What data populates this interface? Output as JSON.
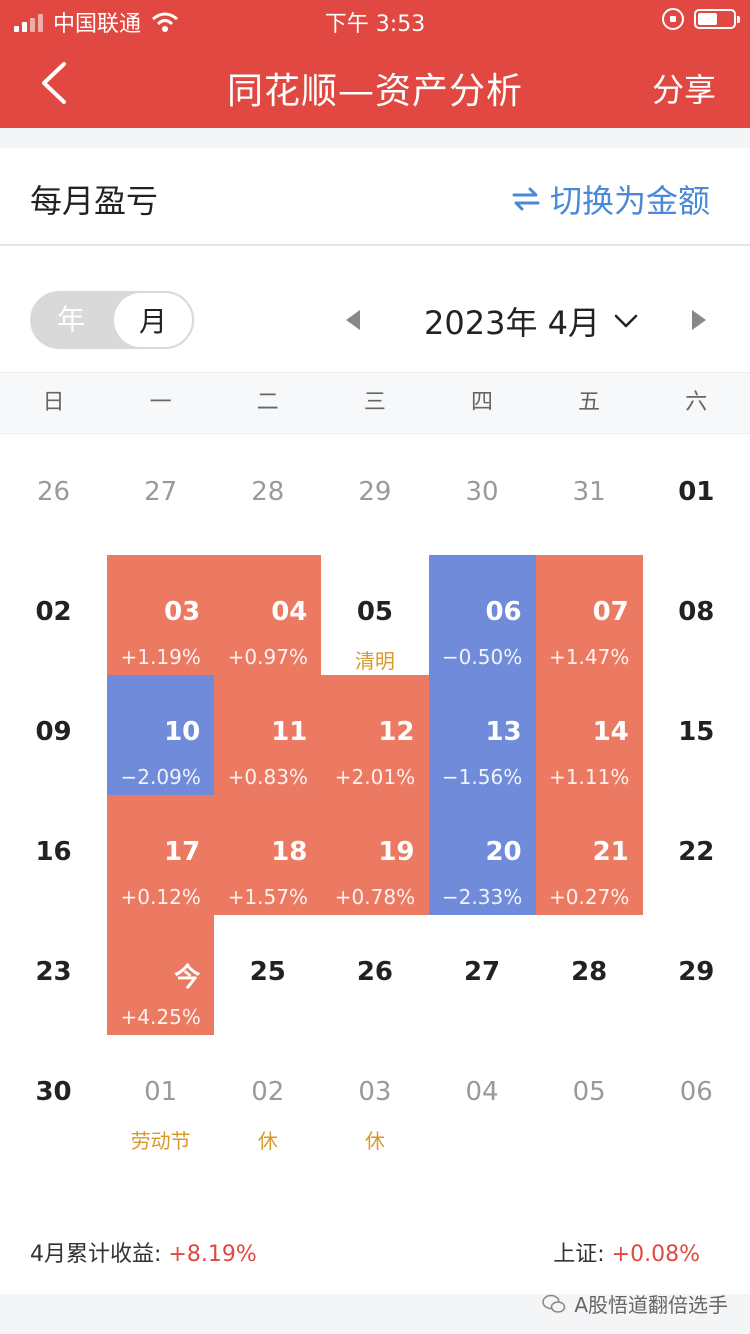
{
  "status_bar": {
    "carrier": "中国联通",
    "time": "下午 3:53"
  },
  "nav": {
    "title": "同花顺—资产分析",
    "share": "分享"
  },
  "section": {
    "title": "每月盈亏",
    "switch_label": "切换为金额"
  },
  "toggle": {
    "year": "年",
    "month": "月",
    "selected": "月"
  },
  "month_label": "2023年 4月",
  "weekdays": [
    "日",
    "一",
    "二",
    "三",
    "四",
    "五",
    "六"
  ],
  "colors": {
    "primary": "#e04841",
    "gain": "#ec7a62",
    "loss": "#6f8bd9",
    "holiday": "#d79a2b",
    "link": "#4a88d8"
  },
  "calendar": [
    [
      {
        "num": "26",
        "other": true
      },
      {
        "num": "27",
        "other": true
      },
      {
        "num": "28",
        "other": true
      },
      {
        "num": "29",
        "other": true
      },
      {
        "num": "30",
        "other": true
      },
      {
        "num": "31",
        "other": true
      },
      {
        "num": "01"
      }
    ],
    [
      {
        "num": "02"
      },
      {
        "num": "03",
        "change": "+1.19%",
        "trend": "up"
      },
      {
        "num": "04",
        "change": "+0.97%",
        "trend": "up"
      },
      {
        "num": "05",
        "note": "清明"
      },
      {
        "num": "06",
        "change": "−0.50%",
        "trend": "down"
      },
      {
        "num": "07",
        "change": "+1.47%",
        "trend": "up"
      },
      {
        "num": "08"
      }
    ],
    [
      {
        "num": "09"
      },
      {
        "num": "10",
        "change": "−2.09%",
        "trend": "down"
      },
      {
        "num": "11",
        "change": "+0.83%",
        "trend": "up"
      },
      {
        "num": "12",
        "change": "+2.01%",
        "trend": "up"
      },
      {
        "num": "13",
        "change": "−1.56%",
        "trend": "down"
      },
      {
        "num": "14",
        "change": "+1.11%",
        "trend": "up"
      },
      {
        "num": "15"
      }
    ],
    [
      {
        "num": "16"
      },
      {
        "num": "17",
        "change": "+0.12%",
        "trend": "up"
      },
      {
        "num": "18",
        "change": "+1.57%",
        "trend": "up"
      },
      {
        "num": "19",
        "change": "+0.78%",
        "trend": "up"
      },
      {
        "num": "20",
        "change": "−2.33%",
        "trend": "down"
      },
      {
        "num": "21",
        "change": "+0.27%",
        "trend": "up"
      },
      {
        "num": "22"
      }
    ],
    [
      {
        "num": "23"
      },
      {
        "num": "今",
        "change": "+4.25%",
        "trend": "up"
      },
      {
        "num": "25"
      },
      {
        "num": "26"
      },
      {
        "num": "27"
      },
      {
        "num": "28"
      },
      {
        "num": "29"
      }
    ],
    [
      {
        "num": "30"
      },
      {
        "num": "01",
        "other": true,
        "note": "劳动节"
      },
      {
        "num": "02",
        "other": true,
        "note": "休"
      },
      {
        "num": "03",
        "other": true,
        "note": "休"
      },
      {
        "num": "04",
        "other": true
      },
      {
        "num": "05",
        "other": true
      },
      {
        "num": "06",
        "other": true
      }
    ]
  ],
  "footer": {
    "cumulative_label": "4月累计收益:",
    "cumulative_value": "+8.19%",
    "index_label": "上证:",
    "index_value": "+0.08%"
  },
  "watermark": "A股悟道翻倍选手"
}
